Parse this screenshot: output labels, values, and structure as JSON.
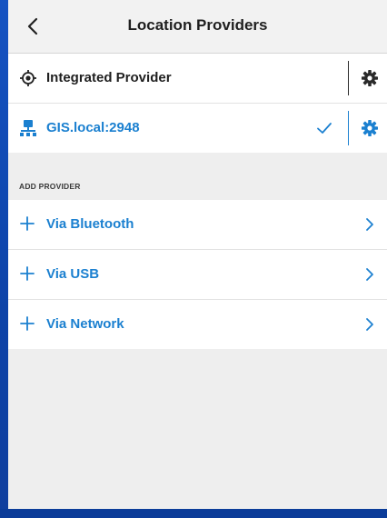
{
  "header": {
    "title": "Location Providers"
  },
  "providers": [
    {
      "name": "Integrated Provider",
      "icon": "target-icon",
      "selected": false
    },
    {
      "name": "GIS.local:2948",
      "icon": "network-icon",
      "selected": true
    }
  ],
  "add_section": {
    "heading": "ADD PROVIDER",
    "items": [
      {
        "label": "Via Bluetooth"
      },
      {
        "label": "Via USB"
      },
      {
        "label": "Via Network"
      }
    ]
  },
  "colors": {
    "accent": "#1b80d0",
    "text": "#1f1f1f",
    "background": "#eeeeee",
    "backdrop": "#0a3d9a"
  }
}
